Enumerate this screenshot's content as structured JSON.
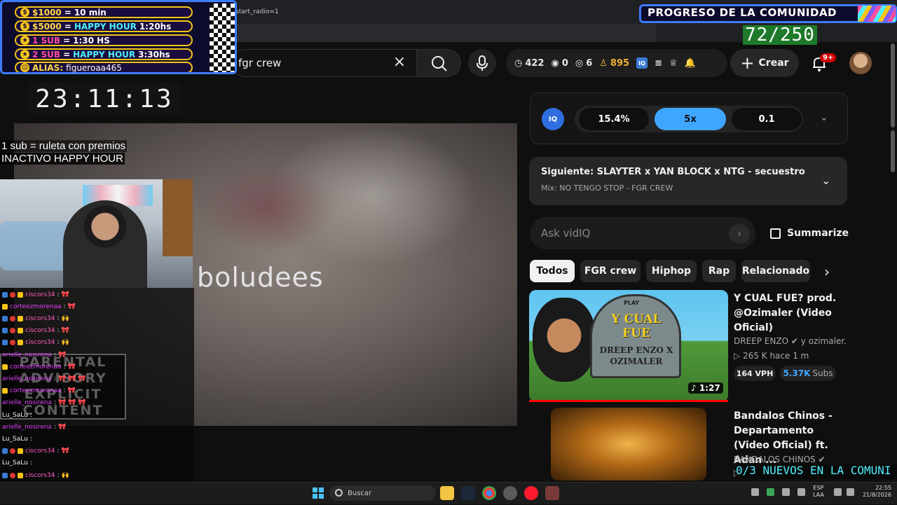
{
  "browser": {
    "url_fragment": "start_radio=1"
  },
  "header": {
    "search_value": "fgr crew",
    "stats": {
      "likes": "422",
      "eye1": "0",
      "eye2": "6",
      "viewers": "895"
    },
    "create_label": "Crear",
    "notification_badge": "9+"
  },
  "overlay": {
    "sub_goals": [
      {
        "amount": "$1000",
        "equals": "=",
        "reward": "10 min",
        "time": ""
      },
      {
        "amount": "$5000",
        "equals": "=",
        "reward": "HAPPY HOUR",
        "time": "1:20hs"
      },
      {
        "amount": "1 SUB",
        "equals": "=",
        "reward": "1:30 HS",
        "time": ""
      },
      {
        "amount": "2 SUB",
        "equals": "=",
        "reward": "HAPPY HOUR",
        "time": "3:30hs"
      }
    ],
    "alias_label": "ALIAS:",
    "alias_value": "figueroaa465",
    "timer": "23:11:13",
    "promo_line1": "1 sub = ruleta con premios",
    "promo_line2": "INACTIVO HAPPY HOUR",
    "community_label": "PROGRESO DE LA COMUNIDAD",
    "community_count": "72/250",
    "goal_ticker": "0/3 NUEVOS EN LA COMUNI",
    "advisory_text": "PARENTAL ADVISORY EXPLICIT CONTENT"
  },
  "video": {
    "caption": "boludees"
  },
  "chat": [
    {
      "name": "ciscors34",
      "msg": "🎀",
      "badges": [
        "b",
        "r",
        "y"
      ],
      "color": "pink"
    },
    {
      "name": "corteezmorenaa",
      "msg": "🎀",
      "badges": [
        "y"
      ],
      "color": "mag"
    },
    {
      "name": "ciscors34",
      "msg": "🙌",
      "badges": [
        "b",
        "r",
        "y"
      ],
      "color": "pink"
    },
    {
      "name": "ciscors34",
      "msg": "🎀",
      "badges": [
        "b",
        "r",
        "y"
      ],
      "color": "pink"
    },
    {
      "name": "ciscors34",
      "msg": "🙌",
      "badges": [
        "b",
        "r",
        "y"
      ],
      "color": "pink"
    },
    {
      "name": "arielle_nosirena",
      "msg": "🎀",
      "badges": [],
      "color": "mag"
    },
    {
      "name": "corteezmorenaa",
      "msg": "🎀",
      "badges": [
        "y"
      ],
      "color": "mag"
    },
    {
      "name": "arielle_nosirena",
      "msg": "🎀 🎀 🎀",
      "badges": [],
      "color": "mag"
    },
    {
      "name": "corteezmorenaa",
      "msg": "🎀",
      "badges": [
        "y"
      ],
      "color": "mag"
    },
    {
      "name": "arielle_nosirena",
      "msg": "🎀 🎀 🎀",
      "badges": [],
      "color": "mag"
    },
    {
      "name": "Lu_SaLu",
      "msg": "",
      "badges": [],
      "color": "white"
    },
    {
      "name": "arielle_nosirena",
      "msg": "🎀",
      "badges": [],
      "color": "mag"
    },
    {
      "name": "Lu_SaLu",
      "msg": "",
      "badges": [],
      "color": "white"
    },
    {
      "name": "ciscors34",
      "msg": "🎀",
      "badges": [
        "b",
        "r",
        "y"
      ],
      "color": "pink"
    },
    {
      "name": "Lu_SaLu",
      "msg": "",
      "badges": [],
      "color": "white"
    },
    {
      "name": "ciscors34",
      "msg": "🙌",
      "badges": [
        "b",
        "r",
        "y"
      ],
      "color": "pink"
    },
    {
      "name": "Lu_SaLu",
      "msg": "",
      "badges": [],
      "color": "white"
    },
    {
      "name": "Lu_SaLu",
      "msg": "",
      "badges": [],
      "color": "white"
    }
  ],
  "vidiq": {
    "logo": "IQ",
    "score": "15.4%",
    "multiplier": "5x",
    "ratio": "0.1"
  },
  "up_next": {
    "title": "Siguiente: SLAYTER x YAN BLOCK x NTG - secuestro (Offi...",
    "subtitle": "Mix: NO TENGO STOP - FGR CREW"
  },
  "ask": {
    "placeholder": "Ask vidIQ",
    "summarize_label": "Summarize"
  },
  "chips": [
    "Todos",
    "FGR crew",
    "Hiphop",
    "Rap",
    "Relacionado"
  ],
  "recommendations": [
    {
      "title": "Y CUAL FUE? prod. @Ozimaler (Video Oficial)",
      "channel": "DREEP ENZO ✔ y ozimaler.",
      "meta": "▷ 265 K  hace 1 m",
      "duration": "♪ 1:27",
      "vph": "164 VPH",
      "subs_num": "5.37K",
      "subs_label": "Subs",
      "thumb_text": "Y CUAL FUE",
      "thumb_text2": "DREEP ENZO X OZIMALER",
      "thumb_play": "PLAY"
    },
    {
      "title": "Bandalos Chinos - Departamento (Video Oficial) ft. Adan ...",
      "channel": "BANDALOS CHINOS ✔",
      "meta": "▷"
    }
  ],
  "taskbar": {
    "search_label": "Buscar",
    "lang": "ESP",
    "lang2": "LAA",
    "time": "22:55",
    "date": "21/8/2026"
  },
  "colors": {
    "accent_blue": "#3ea6ff",
    "youtube_red": "#ff0000",
    "overlay_border": "#3d7cff",
    "gold": "#f5c518"
  }
}
